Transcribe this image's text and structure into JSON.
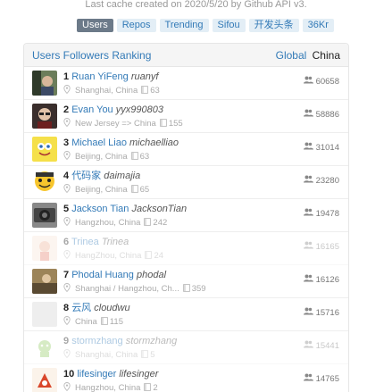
{
  "cache_note": "Last cache created on 2020/5/20 by Github API v3.",
  "nav": {
    "users": "Users",
    "repos": "Repos",
    "trending": "Trending",
    "sifou": "Sifou",
    "kaifa": "开发头条",
    "36kr": "36Kr"
  },
  "panel": {
    "title": "Users Followers Ranking",
    "tab_global": "Global",
    "tab_china": "China"
  },
  "users": [
    {
      "rank": "1",
      "name": "Ruan YiFeng",
      "login": "ruanyf",
      "location": "Shanghai, China",
      "repos": "63",
      "followers": "60658"
    },
    {
      "rank": "2",
      "name": "Evan You",
      "login": "yyx990803",
      "location": "New Jersey => China",
      "repos": "155",
      "followers": "58886"
    },
    {
      "rank": "3",
      "name": "Michael Liao",
      "login": "michaelliao",
      "location": "Beijing, China",
      "repos": "63",
      "followers": "31014"
    },
    {
      "rank": "4",
      "name": "代码家",
      "login": "daimajia",
      "location": "Beijing, China",
      "repos": "65",
      "followers": "23280"
    },
    {
      "rank": "5",
      "name": "Jackson Tian",
      "login": "JacksonTian",
      "location": "Hangzhou, China",
      "repos": "242",
      "followers": "19478"
    },
    {
      "rank": "6",
      "name": "Trinea",
      "login": "Trinea",
      "location": "HangZhou, China",
      "repos": "24",
      "followers": "16165"
    },
    {
      "rank": "7",
      "name": "Phodal Huang",
      "login": "phodal",
      "location": "Shanghai / Hangzhou, Ch...",
      "repos": "359",
      "followers": "16126"
    },
    {
      "rank": "8",
      "name": "云风",
      "login": "cloudwu",
      "location": "China",
      "repos": "115",
      "followers": "15716"
    },
    {
      "rank": "9",
      "name": "stormzhang",
      "login": "stormzhang",
      "location": "Shanghai, China",
      "repos": "5",
      "followers": "15441"
    },
    {
      "rank": "10",
      "name": "lifesinger",
      "login": "lifesinger",
      "location": "Hangzhou, China",
      "repos": "2",
      "followers": "14765"
    }
  ]
}
